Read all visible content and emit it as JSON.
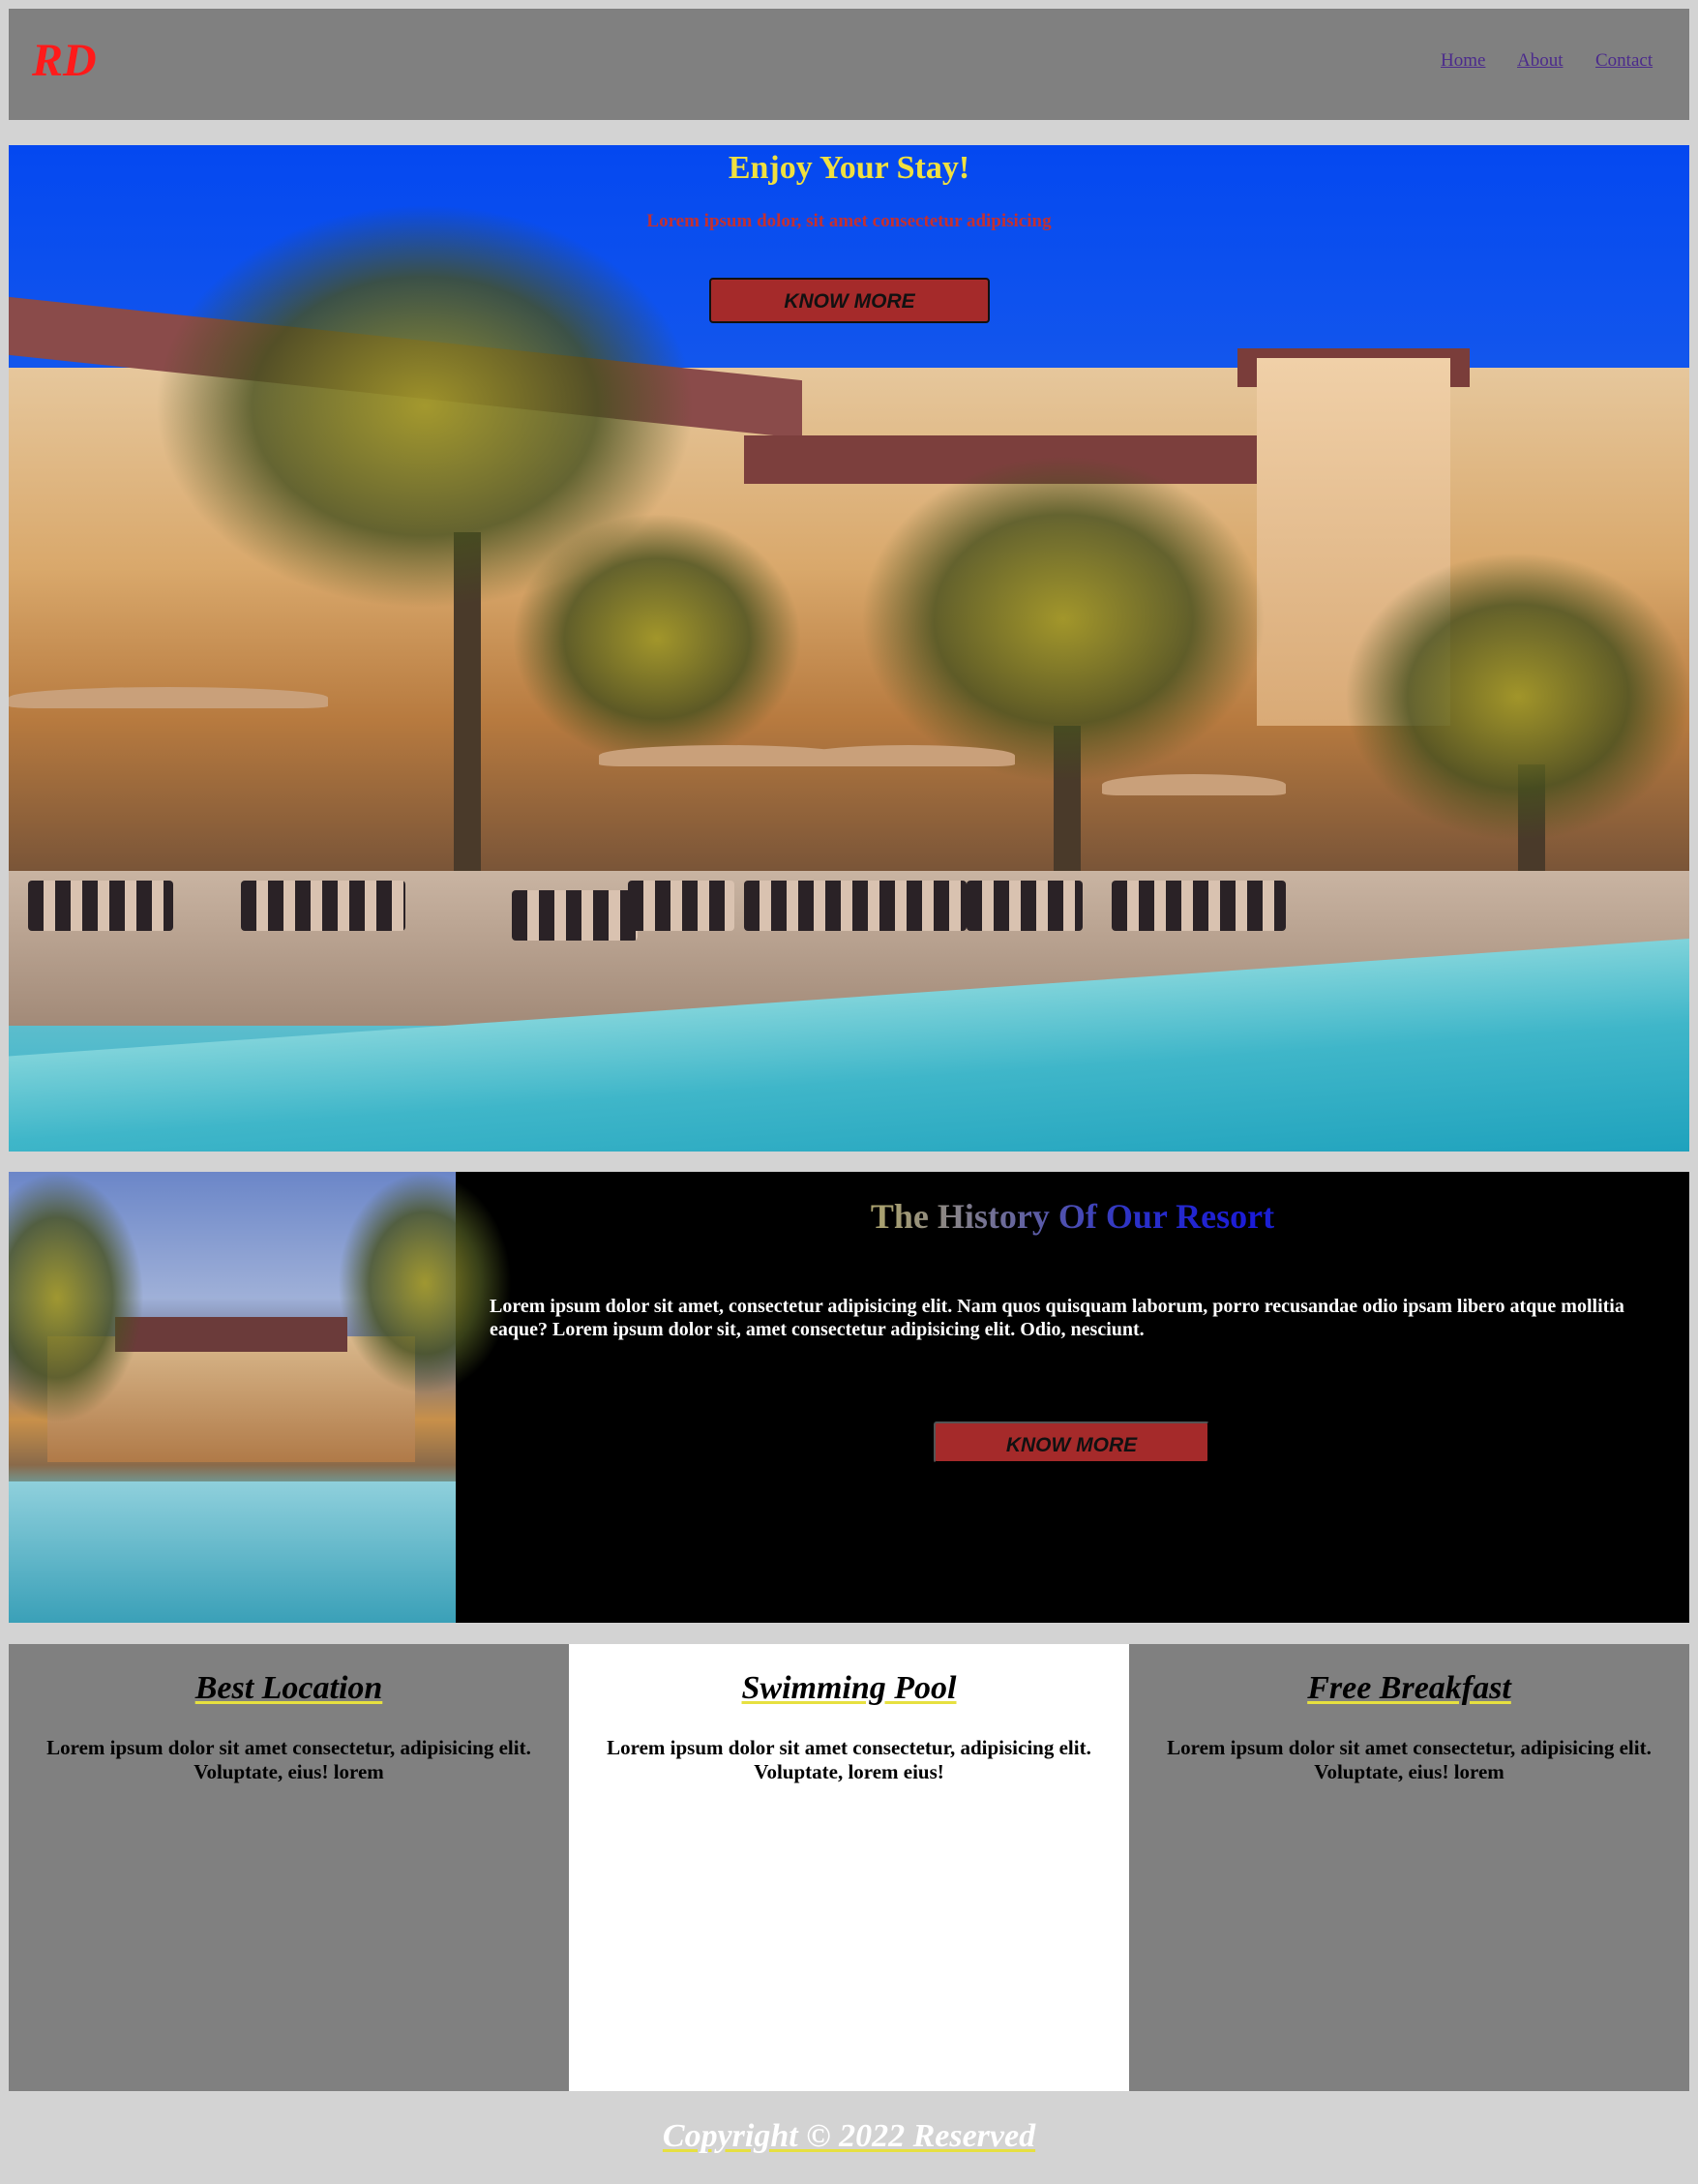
{
  "navbar": {
    "logo": "RD",
    "links": [
      "Home",
      "About",
      "Contact"
    ]
  },
  "hero": {
    "title": "Enjoy Your Stay!",
    "subtitle": "Lorem ipsum dolor, sit amet consectetur adipisicing",
    "button_label": "KNOW MORE"
  },
  "history": {
    "title": "The History Of Our Resort",
    "text": "Lorem ipsum dolor sit amet, consectetur adipisicing elit. Nam quos quisquam laborum, porro recusandae odio ipsam libero atque mollitia eaque? Lorem ipsum dolor sit, amet consectetur adipisicing elit. Odio, nesciunt.",
    "button_label": "KNOW MORE"
  },
  "features": [
    {
      "title": "Best Location",
      "text": "Lorem ipsum dolor sit amet consectetur, adipisicing elit. Voluptate, eius! lorem"
    },
    {
      "title": "Swimming Pool",
      "text": "Lorem ipsum dolor sit amet consectetur, adipisicing elit. Voluptate, lorem eius!"
    },
    {
      "title": "Free Breakfast",
      "text": "Lorem ipsum dolor sit amet consectetur, adipisicing elit. Voluptate, eius! lorem"
    }
  ],
  "footer": {
    "text": "Copyright © 2022 Reserved"
  },
  "colors": {
    "logo": "#ff1a1a",
    "nav_background": "#808080",
    "page_background": "#d3d3d3",
    "hero_title": "#f0e040",
    "hero_subtitle": "#c43030",
    "button_background": "#a52a2a",
    "underline_accent": "#e6e040"
  }
}
